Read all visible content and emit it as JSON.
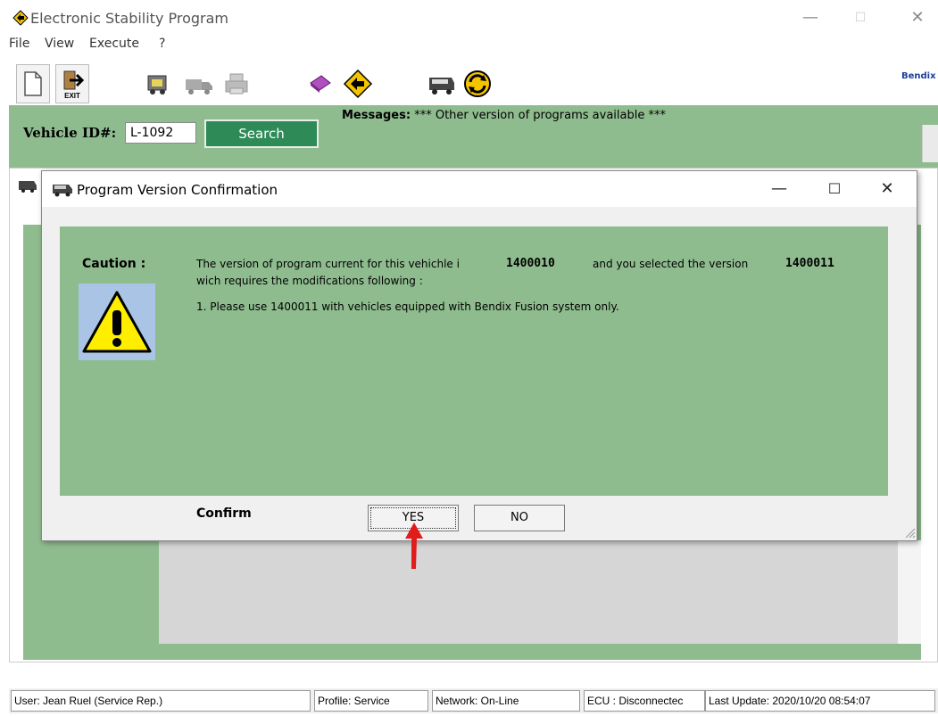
{
  "window": {
    "title": "Electronic Stability Program",
    "minimize": "—",
    "maximize": "☐",
    "close": "✕"
  },
  "menu": [
    "File",
    "View",
    "Execute",
    "?"
  ],
  "toolbar": {
    "icons": [
      "new-document-icon",
      "exit-icon",
      "vehicle-data-icon",
      "truck-icon",
      "printer-icon",
      "book-icon",
      "esp-diamond-icon",
      "bus-icon",
      "refresh-icon"
    ],
    "exit_label": "EXIT",
    "brand_label": "Bendix"
  },
  "header": {
    "vehicle_id_label": "Vehicle ID#:",
    "vehicle_id_value": "L-1092",
    "search_label": "Search",
    "messages_label": "Messages:",
    "messages_text": "*** Other version of programs available ***"
  },
  "dialog": {
    "title": "Program Version Confirmation",
    "minimize": "—",
    "maximize": "☐",
    "close": "✕",
    "caution_label": "Caution :",
    "line1_prefix": "The version of program current for this vehichle i",
    "current_version": "1400010",
    "line1_middle": "and you selected the version",
    "selected_version": "1400011",
    "line2": "wich requires the modifications following :",
    "line3": "1. Please use 1400011 with vehicles equipped with Bendix Fusion system only.",
    "confirm_label": "Confirm",
    "yes_label": "YES",
    "no_label": "NO"
  },
  "status": {
    "user": "User: Jean Ruel (Service Rep.)",
    "profile": "Profile: Service",
    "network": "Network: On-Line",
    "ecu": "ECU : Disconnectec",
    "last_update": "Last Update: 2020/10/20 08:54:07"
  },
  "colors": {
    "panel_green": "#8fbc8f",
    "search_green": "#2e8b57",
    "arrow_red": "#e21b1b",
    "warning_yellow": "#ffee00"
  }
}
